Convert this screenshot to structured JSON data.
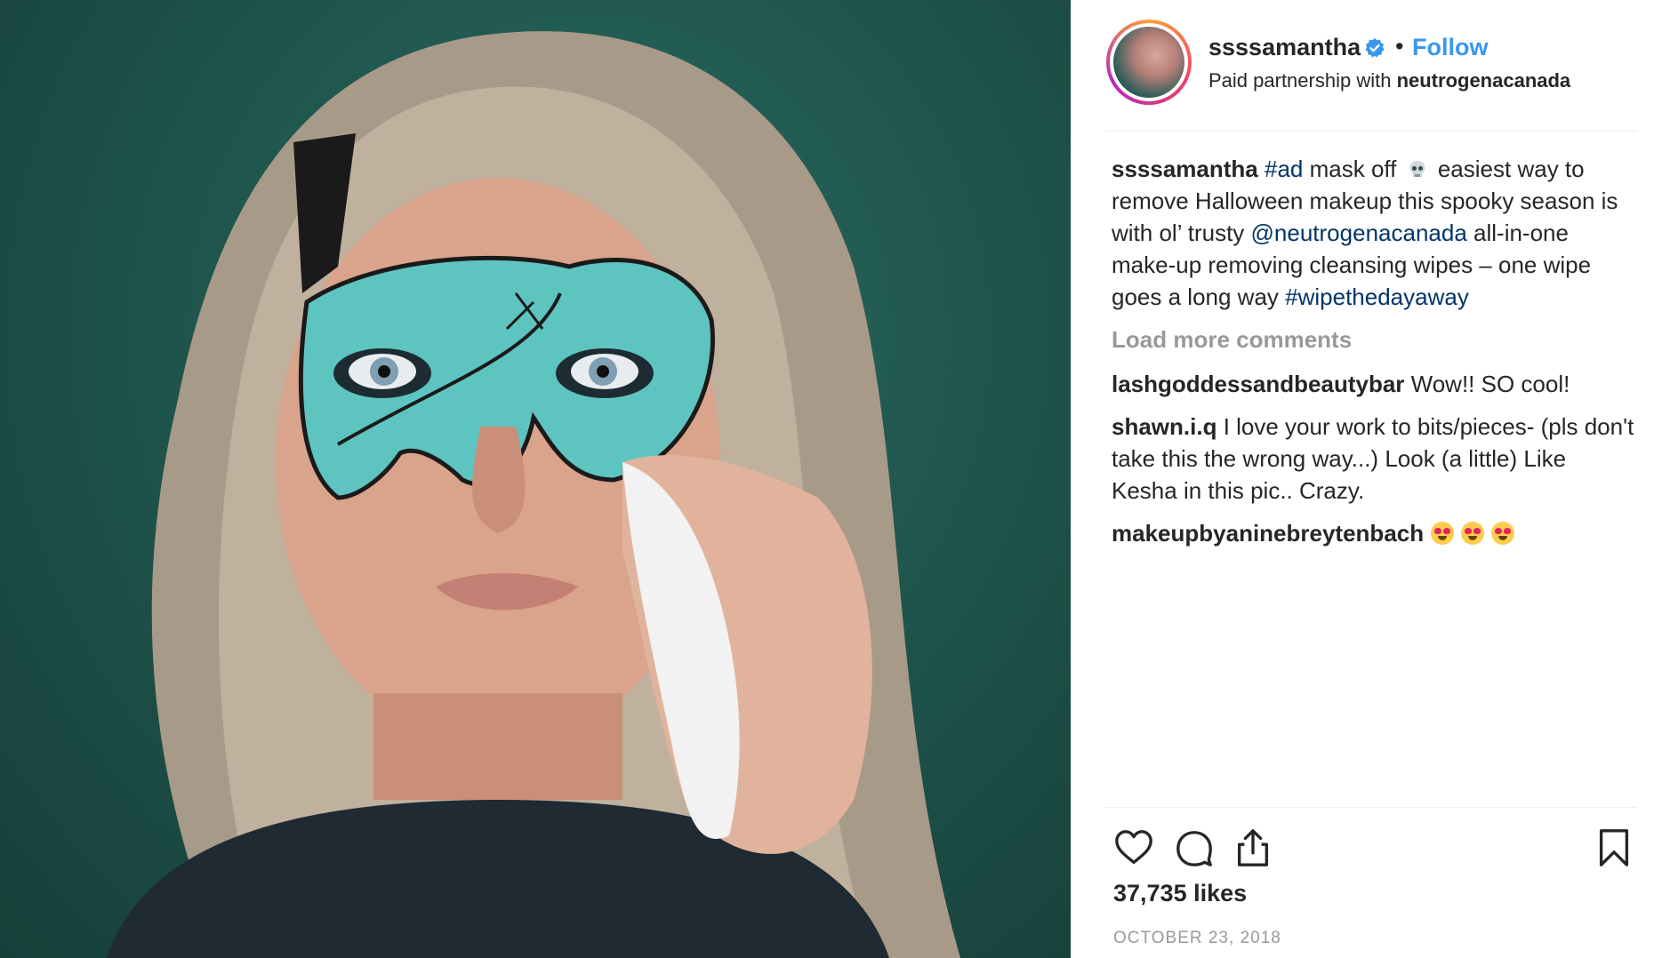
{
  "post": {
    "image_alt": "Photo of woman removing teal mask makeup with a wipe"
  },
  "header": {
    "username": "ssssamantha",
    "separator": "•",
    "follow_label": "Follow",
    "partnership_prefix": "Paid partnership with ",
    "partner": "neutrogenacanada"
  },
  "caption": {
    "username": "ssssamantha",
    "hashtag_ad": "#ad",
    "text_1": " mask off ",
    "text_2": "  easiest way to remove Halloween makeup this spooky season is with ol’ trusty ",
    "mention": "@neutrogenacanada",
    "text_3": " all-in-one make-up removing cleansing wipes – one wipe goes a long way ",
    "hashtag_2": "#wipethedayaway"
  },
  "load_more_label": "Load more comments",
  "comments": [
    {
      "username": "lashgoddessandbeautybar",
      "text": " Wow!! SO cool!"
    },
    {
      "username": "shawn.i.q",
      "text": " I love your work to bits/pieces- (pls don't take this the wrong way...) Look (a little) Like Kesha in this pic.. Crazy."
    },
    {
      "username": "makeupbyaninebreytenbach",
      "text": ""
    }
  ],
  "likes": "37,735 likes",
  "date": "OCTOBER 23, 2018",
  "colors": {
    "link": "#003569",
    "follow": "#3897f0",
    "muted": "#999999",
    "text": "#262626"
  },
  "icons": [
    "verified-badge-icon",
    "heart-icon",
    "comment-icon",
    "share-icon",
    "bookmark-icon",
    "skull-emoji-icon",
    "heart-eyes-emoji-icon"
  ]
}
